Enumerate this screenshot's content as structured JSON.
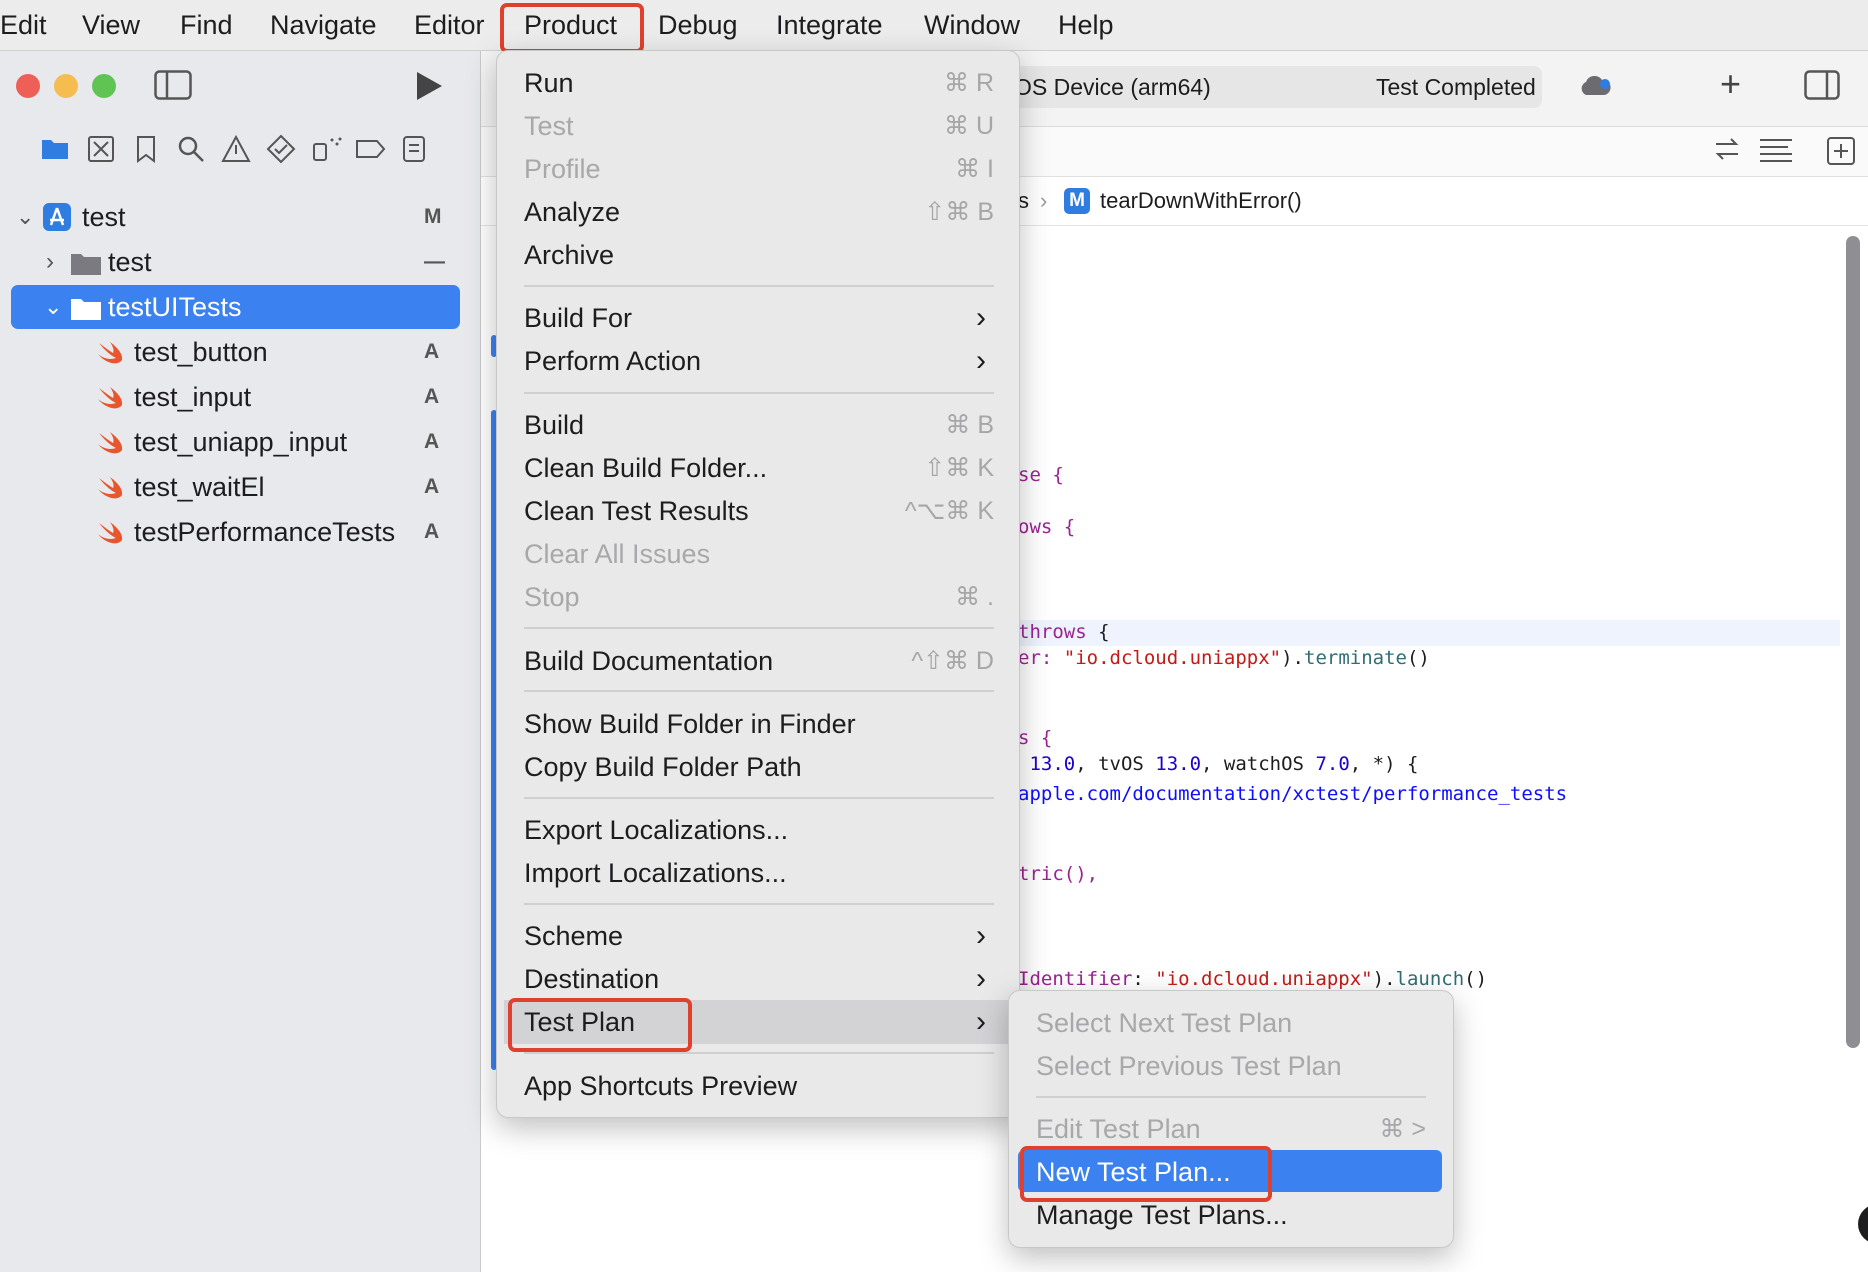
{
  "menubar": {
    "items": [
      "Edit",
      "View",
      "Find",
      "Navigate",
      "Editor",
      "Product",
      "Debug",
      "Integrate",
      "Window",
      "Help"
    ]
  },
  "toolbar": {
    "destination": "OS Device (arm64)",
    "status": "Test Completed",
    "add_label": "+"
  },
  "jump_bar": {
    "trail_fragment": "s",
    "method_badge": "M",
    "method": "tearDownWithError()"
  },
  "navigator": {
    "project": {
      "name": "test",
      "badge": "M"
    },
    "groups": [
      {
        "name": "test",
        "badge": "—",
        "expanded": false
      },
      {
        "name": "testUITests",
        "badge": "",
        "expanded": true,
        "selected": true
      }
    ],
    "files": [
      {
        "name": "test_button",
        "badge": "A"
      },
      {
        "name": "test_input",
        "badge": "A"
      },
      {
        "name": "test_uniapp_input",
        "badge": "A"
      },
      {
        "name": "test_waitEl",
        "badge": "A"
      },
      {
        "name": "testPerformanceTests",
        "badge": "A"
      }
    ]
  },
  "code": {
    "l1": "se {",
    "l2": "ows {",
    "l3a": "throws",
    "l3b": " {",
    "l4a": "er: ",
    "l4b": "\"io.dcloud.uniappx\"",
    "l4c": ").",
    "l4d": "terminate",
    "l4e": "()",
    "l5": "s {",
    "l6a": " 13.0",
    "l6b": ", tvOS ",
    "l6c": "13.0",
    "l6d": ", watchOS ",
    "l6e": "7.0",
    "l6f": ", *) {",
    "l7": "apple.com/documentation/xctest/performance_tests",
    "l8": "tric(),",
    "l9a": "Identifier",
    "l9b": ": ",
    "l9c": "\"io.dcloud.uniappx\"",
    "l9d": ").",
    "l9e": "launch",
    "l9f": "()"
  },
  "product_menu": {
    "items": [
      {
        "label": "Run",
        "shortcut": "⌘ R",
        "enabled": true
      },
      {
        "label": "Test",
        "shortcut": "⌘ U",
        "enabled": false
      },
      {
        "label": "Profile",
        "shortcut": "⌘ I",
        "enabled": false
      },
      {
        "label": "Analyze",
        "shortcut": "⇧⌘ B",
        "enabled": true
      },
      {
        "label": "Archive",
        "shortcut": "",
        "enabled": true
      },
      {
        "label": "Build For",
        "submenu": true,
        "enabled": true
      },
      {
        "label": "Perform Action",
        "submenu": true,
        "enabled": true
      },
      {
        "label": "Build",
        "shortcut": "⌘ B",
        "enabled": true
      },
      {
        "label": "Clean Build Folder...",
        "shortcut": "⇧⌘ K",
        "enabled": true
      },
      {
        "label": "Clean Test Results",
        "shortcut": "^⌥⌘ K",
        "enabled": true
      },
      {
        "label": "Clear All Issues",
        "shortcut": "",
        "enabled": false
      },
      {
        "label": "Stop",
        "shortcut": "⌘ .",
        "enabled": false
      },
      {
        "label": "Build Documentation",
        "shortcut": "^⇧⌘ D",
        "enabled": true
      },
      {
        "label": "Show Build Folder in Finder",
        "shortcut": "",
        "enabled": true
      },
      {
        "label": "Copy Build Folder Path",
        "shortcut": "",
        "enabled": true
      },
      {
        "label": "Export Localizations...",
        "shortcut": "",
        "enabled": true
      },
      {
        "label": "Import Localizations...",
        "shortcut": "",
        "enabled": true
      },
      {
        "label": "Scheme",
        "submenu": true,
        "enabled": true
      },
      {
        "label": "Destination",
        "submenu": true,
        "enabled": true
      },
      {
        "label": "Test Plan",
        "submenu": true,
        "enabled": true,
        "highlighted": true
      },
      {
        "label": "App Shortcuts Preview",
        "shortcut": "",
        "enabled": true
      }
    ]
  },
  "test_plan_submenu": {
    "items": [
      {
        "label": "Select Next Test Plan",
        "enabled": false
      },
      {
        "label": "Select Previous Test Plan",
        "enabled": false
      },
      {
        "label": "Edit Test Plan",
        "shortcut": "⌘ >",
        "enabled": false
      },
      {
        "label": "New Test Plan...",
        "enabled": true,
        "selected": true
      },
      {
        "label": "Manage Test Plans...",
        "enabled": true
      }
    ]
  },
  "colors": {
    "accent": "#3b82f0",
    "callout": "#e0402e",
    "close": "#ee5f57",
    "minimize": "#f5bd4f",
    "zoom": "#5fc454"
  }
}
